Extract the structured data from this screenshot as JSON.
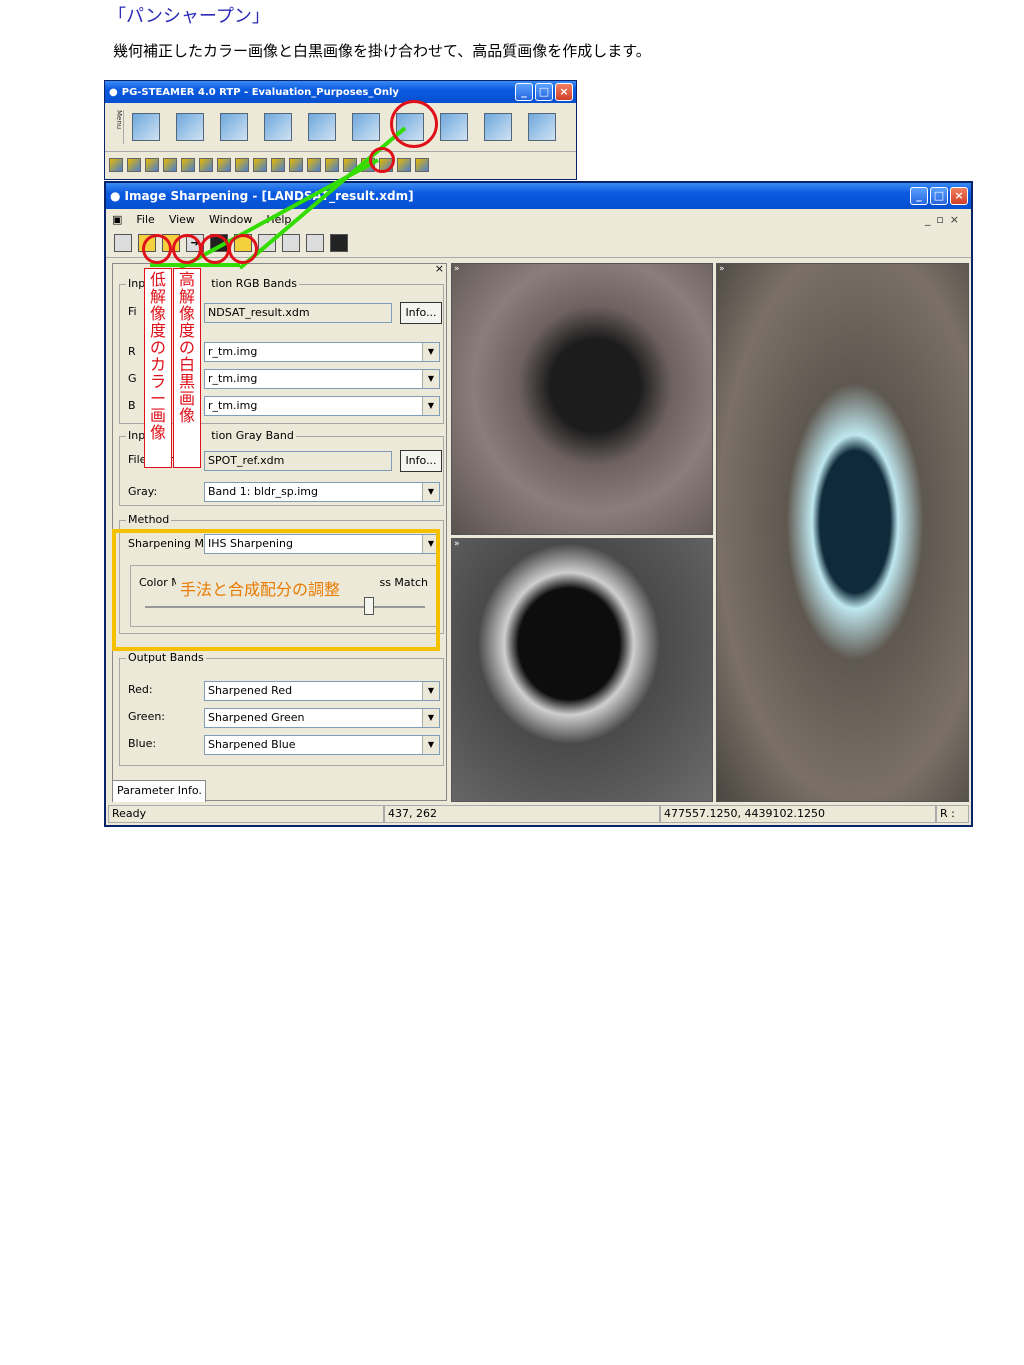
{
  "heading": "「パンシャープン」",
  "description": "幾何補正したカラー画像と白黒画像を掛け合わせて、高品質画像を作成します。",
  "toolbar_window": {
    "title": "PG-STEAMER 4.0 RTP - Evaluation_Purposes_Only",
    "menu_label": "Menu"
  },
  "app_window": {
    "title": "Image Sharpening - [LANDSAT_result.xdm]",
    "menu": {
      "file": "File",
      "view": "View",
      "window": "Window",
      "help": "Help"
    }
  },
  "panel": {
    "rgb_group": "Input Resolution RGB Bands",
    "file_name_label_short": "Fi",
    "file_name_value": "NDSAT_result.xdm",
    "info_label": "Info...",
    "r_label": "R",
    "g_label": "G",
    "b_label": "B",
    "r_value": "r_tm.img",
    "g_value": "r_tm.img",
    "b_value": "r_tm.img",
    "gray_group": "Input Resolution Gray Band",
    "gray_group_short": "Inp",
    "gray_group_tail": "tion Gray Band",
    "rgb_group_short": "Inp",
    "rgb_group_tail": "tion RGB Bands",
    "gray_file_label": "File Name:",
    "gray_file_value": "SPOT_ref.xdm",
    "gray_label": "Gray:",
    "gray_value": "Band 1: bldr_sp.img",
    "method_group": "Method",
    "sharpening_method_label": "Sharpening Method:",
    "sharpening_method_value": "IHS Sharpening",
    "color_match_label": "Color M",
    "color_match_tail": "ss Match",
    "slider_value": 0.8,
    "output_group": "Output Bands",
    "red_label": "Red:",
    "green_label": "Green:",
    "blue_label": "Blue:",
    "red_value": "Sharpened Red",
    "green_value": "Sharpened Green",
    "blue_value": "Sharpened Blue",
    "tab_label": "Parameter Info."
  },
  "status": {
    "ready": "Ready",
    "pixel": "437, 262",
    "coords": "477557.1250, 4439102.1250",
    "r": "R :"
  },
  "annotations": {
    "low_res_color": [
      "低",
      "解",
      "像",
      "度",
      "の",
      "カ",
      "ラ",
      "ー",
      "画",
      "像"
    ],
    "high_res_bw": [
      "高",
      "解",
      "像",
      "度",
      "の",
      "白",
      "黒",
      "画",
      "像"
    ],
    "method_note": "手法と合成配分の調整"
  },
  "colors": {
    "annotation_red": "#e0101a",
    "annotation_green": "#33dd00",
    "annotation_yellow": "#f5c000",
    "annotation_orange": "#e97a00",
    "heading_blue": "#2b2bb8"
  }
}
